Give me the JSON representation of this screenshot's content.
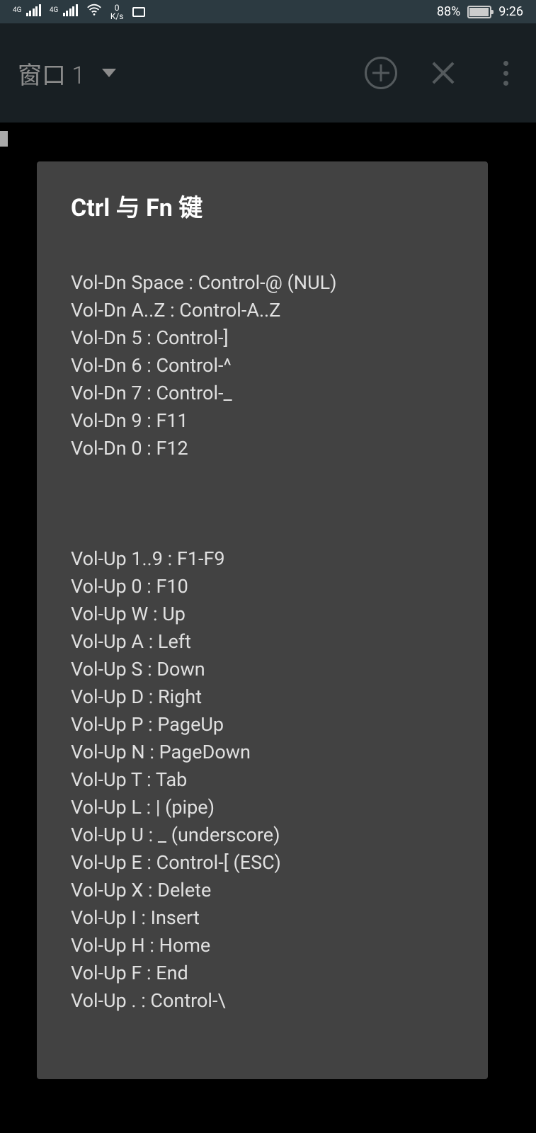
{
  "statusbar": {
    "signal1_label": "4G",
    "signal2_label": "4G",
    "netspeed_top": "0",
    "netspeed_bottom": "K/s",
    "battery_pct": "88%",
    "time": "9:26"
  },
  "appbar": {
    "tab_title": "窗口 1"
  },
  "dialog": {
    "title": "Ctrl 与 Fn 键",
    "lines_a": [
      "Vol-Dn Space : Control-@ (NUL)",
      "Vol-Dn A..Z : Control-A..Z",
      "Vol-Dn 5 : Control-]",
      "Vol-Dn 6 : Control-^",
      "Vol-Dn 7 : Control-_",
      "Vol-Dn 9 : F11",
      "Vol-Dn 0 : F12"
    ],
    "lines_b": [
      "Vol-Up 1..9 : F1-F9",
      "Vol-Up 0 : F10",
      "Vol-Up W : Up",
      "Vol-Up A : Left",
      "Vol-Up S : Down",
      "Vol-Up D : Right",
      "Vol-Up P : PageUp",
      "Vol-Up N : PageDown",
      "Vol-Up T : Tab",
      "Vol-Up L : | (pipe)",
      "Vol-Up U : _ (underscore)",
      "Vol-Up E : Control-[ (ESC)",
      "Vol-Up X : Delete",
      "Vol-Up I : Insert",
      "Vol-Up H : Home",
      "Vol-Up F : End",
      "Vol-Up . : Control-\\"
    ]
  }
}
